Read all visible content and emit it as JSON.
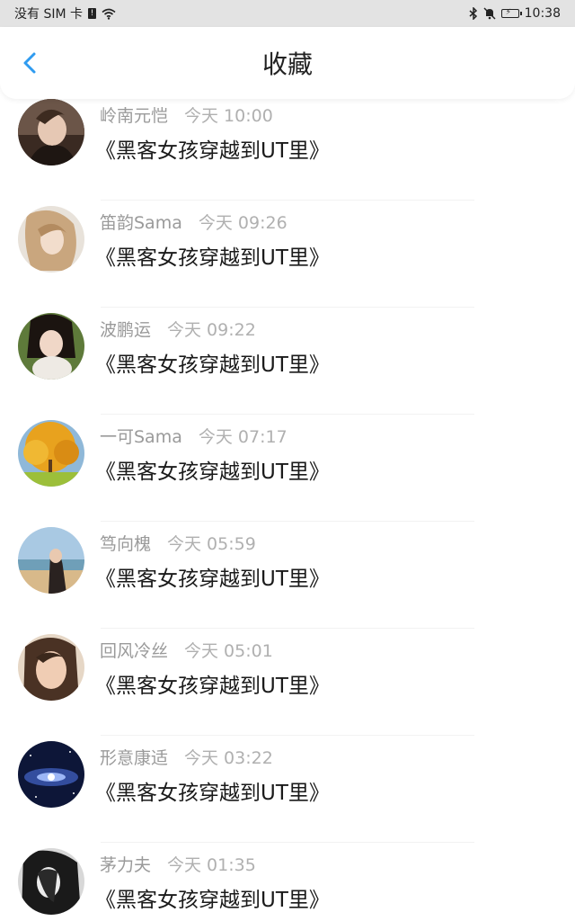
{
  "status_bar": {
    "carrier": "没有 SIM 卡",
    "time": "10:38",
    "icons": [
      "sim-icon",
      "wifi-icon",
      "bluetooth-icon",
      "mute-icon",
      "battery-icon"
    ]
  },
  "header": {
    "title": "收藏",
    "back_icon": "chevron-left-icon",
    "accent_color": "#2f9bf0"
  },
  "items": [
    {
      "name": "岭南元恺",
      "time": "今天 10:00",
      "text": "《黑客女孩穿越到UT里》",
      "avatar": "avatar-1"
    },
    {
      "name": "笛韵Sama",
      "time": "今天 09:26",
      "text": "《黑客女孩穿越到UT里》",
      "avatar": "avatar-2"
    },
    {
      "name": "波鹏运",
      "time": "今天 09:22",
      "text": "《黑客女孩穿越到UT里》",
      "avatar": "avatar-3"
    },
    {
      "name": "一可Sama",
      "time": "今天 07:17",
      "text": "《黑客女孩穿越到UT里》",
      "avatar": "avatar-4"
    },
    {
      "name": "笃向槐",
      "time": "今天 05:59",
      "text": "《黑客女孩穿越到UT里》",
      "avatar": "avatar-5"
    },
    {
      "name": "回风冷丝",
      "time": "今天 05:01",
      "text": "《黑客女孩穿越到UT里》",
      "avatar": "avatar-6"
    },
    {
      "name": "形意康适",
      "time": "今天 03:22",
      "text": "《黑客女孩穿越到UT里》",
      "avatar": "avatar-7"
    },
    {
      "name": "茅力夫",
      "time": "今天 01:35",
      "text": "《黑客女孩穿越到UT里》",
      "avatar": "avatar-8"
    }
  ]
}
